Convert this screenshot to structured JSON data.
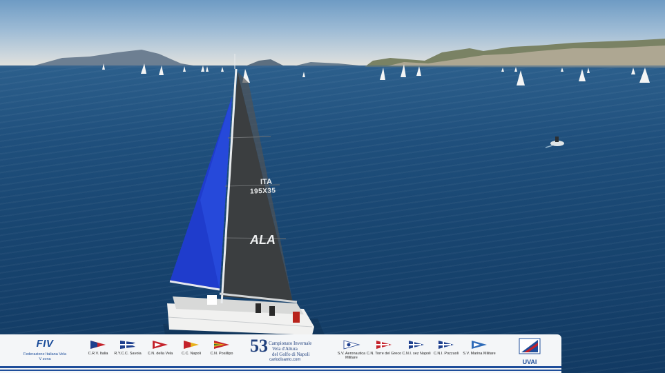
{
  "sail": {
    "country": "ITA",
    "number": "195X35",
    "name": "ALA"
  },
  "sponsor_bar": {
    "fiv": {
      "mark": "FIV",
      "name": "Federazione Italiana Vela",
      "zone": "V zona"
    },
    "clubs_left": [
      {
        "label": "C.R.V. Italia"
      },
      {
        "label": "R.Y.C.C. Savoia"
      },
      {
        "label": "C.N. della Vela"
      },
      {
        "label": "C.C. Napoli"
      },
      {
        "label": "C.N. Posillipo"
      }
    ],
    "championship": {
      "number": "53",
      "line1": "Campionato Invernale",
      "line2": "Vela d'Altura",
      "line3": "del Golfo di Napoli",
      "url": "carlodisanto.com"
    },
    "clubs_right": [
      {
        "label": "S.V. Aeronautica Militare"
      },
      {
        "label": "C.N. Torre del Greco"
      },
      {
        "label": "C.N.I. sez Napoli"
      },
      {
        "label": "C.N.I. Pozzuoli"
      },
      {
        "label": "S.V. Marina Militare"
      }
    ],
    "uvai": {
      "label": "UVAI"
    }
  },
  "colors": {
    "spinnaker": "#1e3fd1",
    "mainsail": "#3a3d3f",
    "sea": "#1b4a77",
    "bar_line": "#1f4e9a"
  }
}
